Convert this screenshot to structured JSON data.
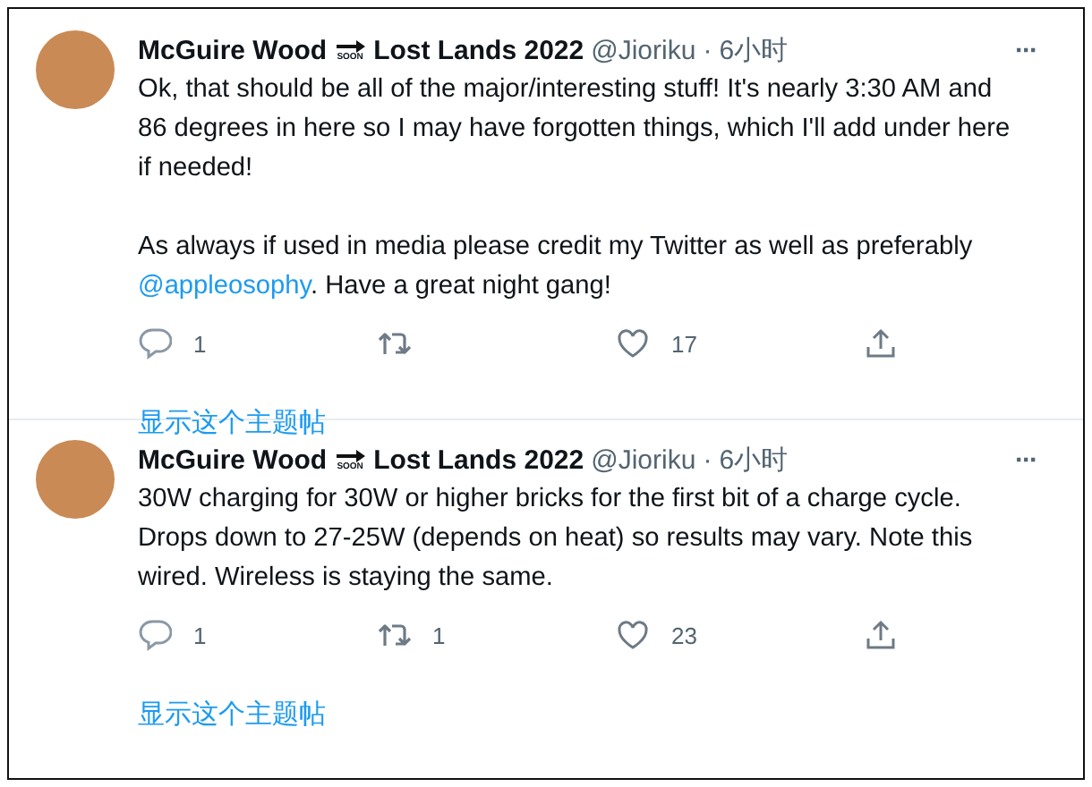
{
  "tweets": [
    {
      "author": {
        "name_start": "McGuire Wood",
        "emoji_label": "SOON",
        "name_end": "Lost Lands 2022"
      },
      "handle": "@Jioriku",
      "separator": "·",
      "time": "6小时",
      "more": "···",
      "paragraphs": [
        [
          {
            "kind": "text",
            "text": "Ok, that should be all of the major/interesting stuff! It's nearly 3:30 AM and 86 degrees in here so I may have forgotten things, which I'll add under here if needed!"
          }
        ],
        [
          {
            "kind": "text",
            "text": "As always if used in media please credit my Twitter as well as preferably "
          },
          {
            "kind": "mention",
            "text": "@appleosophy"
          },
          {
            "kind": "text",
            "text": ". Have a great night gang!"
          }
        ]
      ],
      "actions": {
        "replies": "1",
        "likes": "17"
      },
      "show_thread": "显示这个主题帖"
    },
    {
      "author": {
        "name_start": "McGuire Wood",
        "emoji_label": "SOON",
        "name_end": "Lost Lands 2022"
      },
      "handle": "@Jioriku",
      "separator": "·",
      "time": "6小时",
      "more": "···",
      "paragraphs": [
        [
          {
            "kind": "text",
            "text": "30W charging for 30W or higher bricks for the first bit of a charge cycle. Drops down to 27-25W (depends on heat) so results may vary. Note this wired. Wireless is staying the same."
          }
        ]
      ],
      "actions": {
        "replies": "1",
        "retweets": "1",
        "likes": "23"
      },
      "show_thread": "显示这个主题帖"
    }
  ]
}
